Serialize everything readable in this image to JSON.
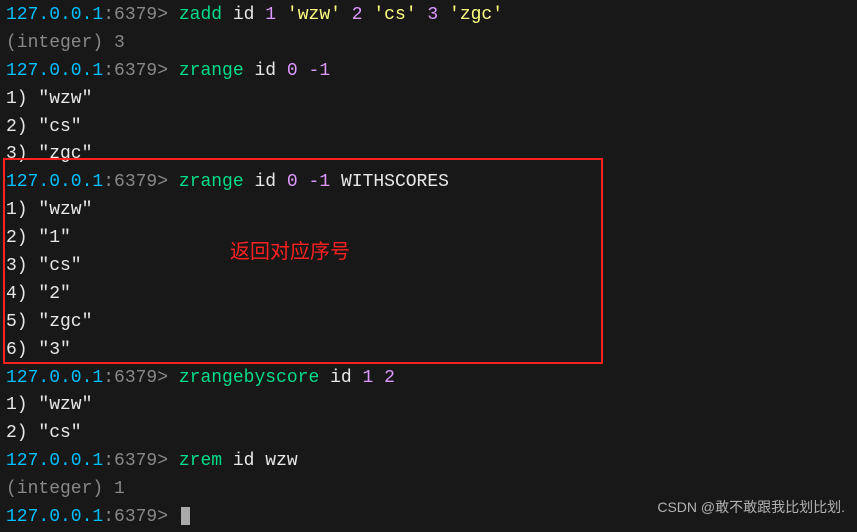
{
  "host": "127.0.0.1",
  "port": ":6379>",
  "lines": {
    "l1_cmd": "zadd",
    "l1_key": "id",
    "l1_s1": "1",
    "l1_m1": "'wzw'",
    "l1_s2": "2",
    "l1_m2": "'cs'",
    "l1_s3": "3",
    "l1_m3": "'zgc'",
    "l2": "(integer) 3",
    "l3_cmd": "zrange",
    "l3_key": "id",
    "l3_a": "0",
    "l3_b": "-1",
    "l4": "1) \"wzw\"",
    "l5": "2) \"cs\"",
    "l6": "3) \"zgc\"",
    "l7_cmd": "zrange",
    "l7_key": "id",
    "l7_a": "0",
    "l7_b": "-1",
    "l7_opt": "WITHSCORES",
    "l8": "1) \"wzw\"",
    "l9": "2) \"1\"",
    "l10": "3) \"cs\"",
    "l11": "4) \"2\"",
    "l12": "5) \"zgc\"",
    "l13": "6) \"3\"",
    "l14_cmd": "zrangebyscore",
    "l14_key": "id",
    "l14_a": "1",
    "l14_b": "2",
    "l15": "1) \"wzw\"",
    "l16": "2) \"cs\"",
    "l17_cmd": "zrem",
    "l17_key": "id",
    "l17_a": "wzw",
    "l18": "(integer) 1"
  },
  "annotation": "返回对应序号",
  "watermark": "CSDN @敢不敢跟我比划比划."
}
